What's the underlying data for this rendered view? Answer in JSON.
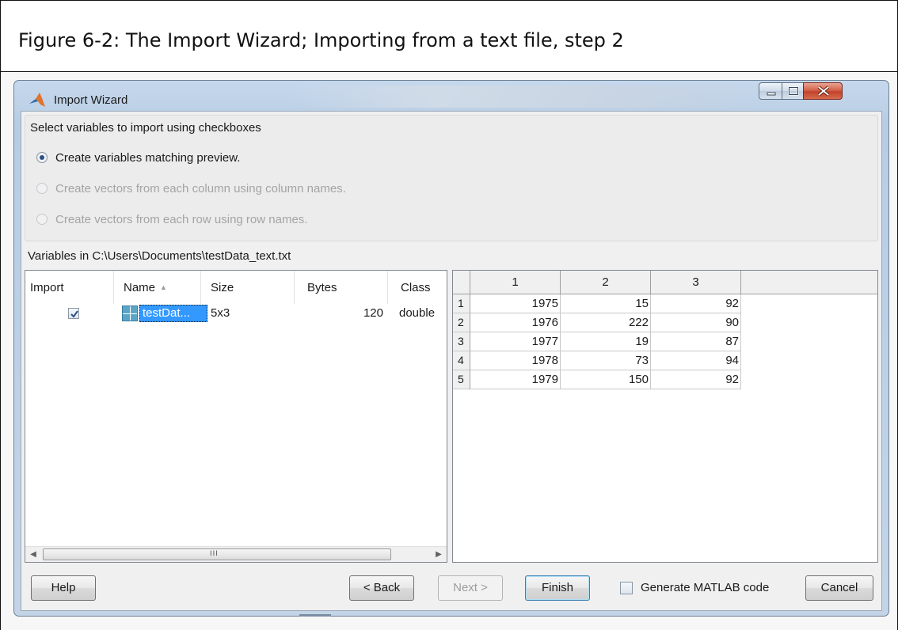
{
  "figure": {
    "caption": "Figure 6-2: The Import Wizard; Importing from a text file, step 2"
  },
  "window": {
    "title": "Import Wizard",
    "icon": "matlab-logo-icon",
    "controls": [
      "minimize-icon",
      "maximize-icon",
      "close-icon"
    ]
  },
  "options": {
    "group_title": "Select variables to import using checkboxes",
    "radios": [
      {
        "label": "Create variables matching preview.",
        "checked": true,
        "enabled": true
      },
      {
        "label": "Create vectors from each column using column names.",
        "checked": false,
        "enabled": false
      },
      {
        "label": "Create vectors from each row using row names.",
        "checked": false,
        "enabled": false
      }
    ]
  },
  "variables": {
    "label": "Variables in C:\\Users\\Documents\\testData_text.txt",
    "columns": [
      "Import",
      "Name",
      "Size",
      "Bytes",
      "Class"
    ],
    "sort_indicator": "▲",
    "rows": [
      {
        "import": true,
        "name": "testDat...",
        "size": "5x3",
        "bytes": "120",
        "class": "double"
      }
    ],
    "scroll_left": "◀",
    "scroll_right": "▶",
    "scroll_grip": "III"
  },
  "preview": {
    "column_headers": [
      "1",
      "2",
      "3"
    ],
    "row_headers": [
      "1",
      "2",
      "3",
      "4",
      "5"
    ],
    "rows": [
      [
        "1975",
        "15",
        "92"
      ],
      [
        "1976",
        "222",
        "90"
      ],
      [
        "1977",
        "19",
        "87"
      ],
      [
        "1978",
        "73",
        "94"
      ],
      [
        "1979",
        "150",
        "92"
      ]
    ]
  },
  "buttons": {
    "help": "Help",
    "back": "< Back",
    "next": "Next >",
    "finish": "Finish",
    "generate_code": "Generate MATLAB code",
    "generate_code_checked": false,
    "cancel": "Cancel"
  },
  "colors": {
    "selection": "#3399ff",
    "title_gradient": "#c6d8ec",
    "close_button": "#c2422a"
  }
}
